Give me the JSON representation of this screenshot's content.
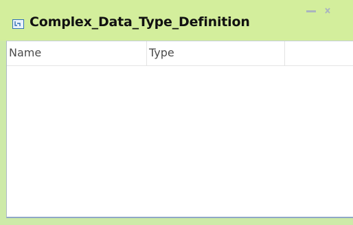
{
  "window": {
    "title": "Complex_Data_Type_Definition",
    "title_icon": "data-type-icon",
    "minimize_icon": "minimize-icon",
    "close_icon": "close-icon"
  },
  "table": {
    "columns": [
      "Name",
      "Type",
      ""
    ],
    "rows": []
  },
  "colors": {
    "titlebar_bg": "#d3ee9c",
    "frame_border": "#8fa7c7",
    "header_text": "#4a4a4a"
  }
}
